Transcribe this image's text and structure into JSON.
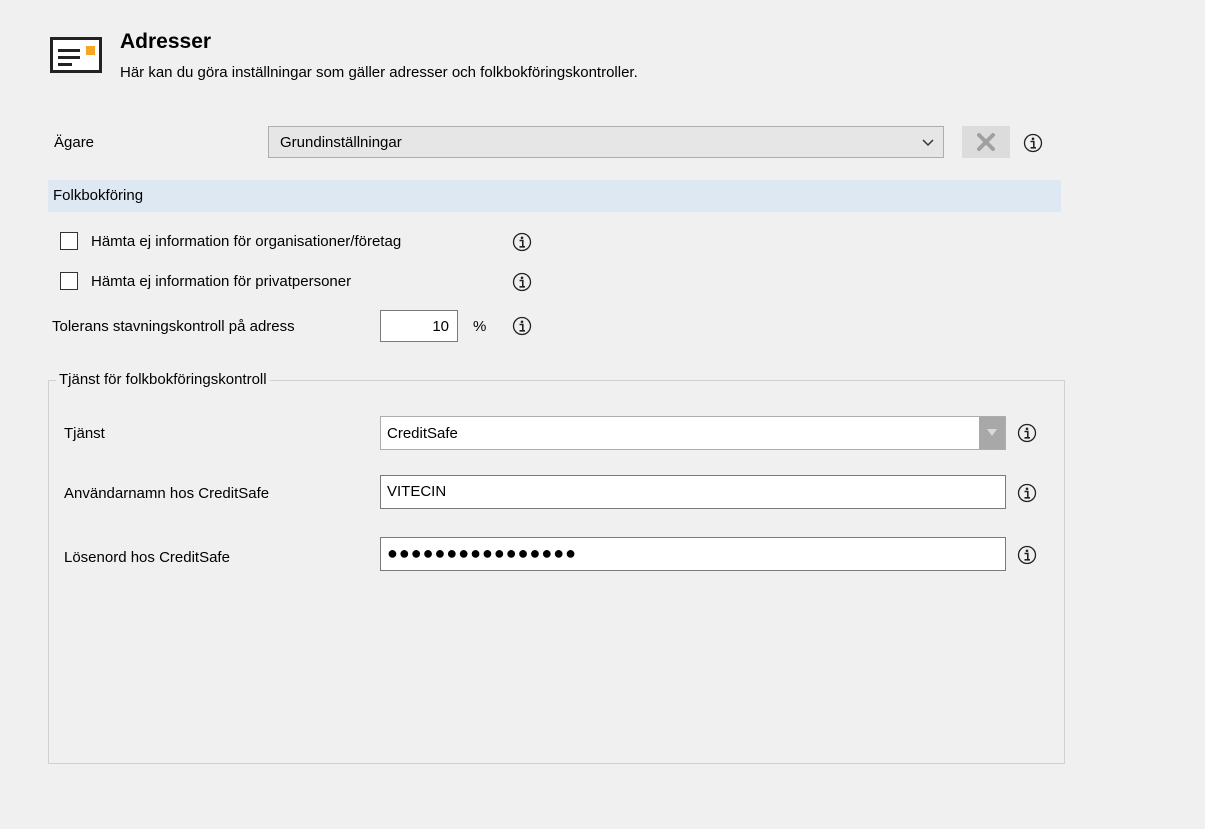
{
  "header": {
    "icon": "address-card-icon",
    "title": "Adresser",
    "subtitle": "Här kan du göra inställningar som gäller adresser och folkbokföringskontroller."
  },
  "owner": {
    "label": "Ägare",
    "value": "Grundinställningar",
    "clear_icon": "close-icon",
    "info_icon": "info-icon"
  },
  "section": {
    "title": "Folkbokföring"
  },
  "options": [
    {
      "label": "Hämta ej information för organisationer/företag",
      "checked": false
    },
    {
      "label": "Hämta ej information för privatpersoner",
      "checked": false
    }
  ],
  "tolerance": {
    "label": "Tolerans stavningskontroll på adress",
    "value": "10",
    "unit": "%"
  },
  "service_group": {
    "title": "Tjänst för folkbokföringskontroll",
    "service_label": "Tjänst",
    "service_value": "CreditSafe",
    "username_label": "Användarnamn hos CreditSafe",
    "username_value": "VITECIN",
    "password_label": "Lösenord hos CreditSafe",
    "password_value": "●●●●●●●●●●●●●●●●"
  },
  "colors": {
    "section_bar": "#dde8f3",
    "icon_accent": "#f5a623",
    "background": "#f0f0f0"
  }
}
